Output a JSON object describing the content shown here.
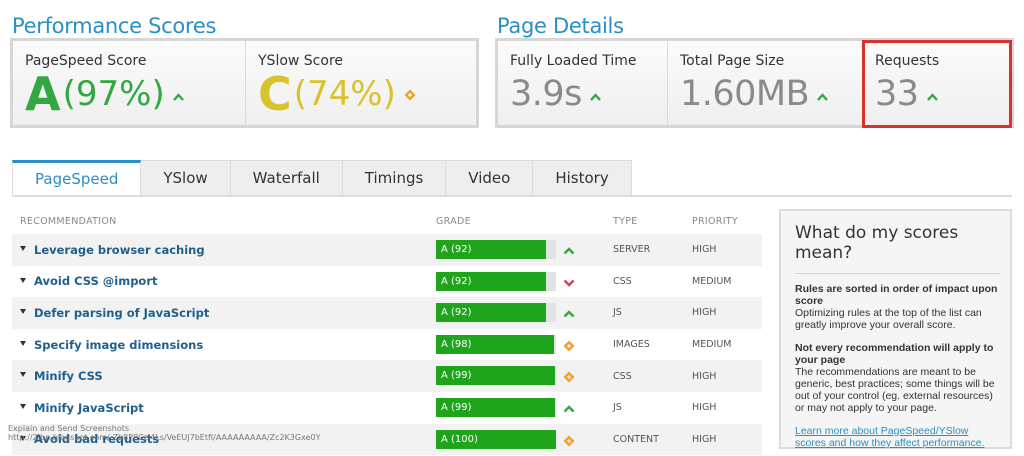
{
  "performance": {
    "title": "Performance Scores",
    "pagespeed": {
      "label": "PageSpeed Score",
      "grade": "A",
      "pct": "(97%)",
      "color": "#33a742"
    },
    "yslow": {
      "label": "YSlow Score",
      "grade": "C",
      "pct": "(74%)",
      "color": "#d9c22e"
    }
  },
  "page_details": {
    "title": "Page Details",
    "fully_loaded": {
      "label": "Fully Loaded Time",
      "value": "3.9s"
    },
    "page_size": {
      "label": "Total Page Size",
      "value": "1.60MB"
    },
    "requests": {
      "label": "Requests",
      "value": "33"
    }
  },
  "tabs": [
    "PageSpeed",
    "YSlow",
    "Waterfall",
    "Timings",
    "Video",
    "History"
  ],
  "table": {
    "headers": {
      "recommendation": "RECOMMENDATION",
      "grade": "GRADE",
      "type": "TYPE",
      "priority": "PRIORITY"
    },
    "rows": [
      {
        "name": "Leverage browser caching",
        "grade": "A (92)",
        "score": 92,
        "trend": "up-icon",
        "type": "SERVER",
        "priority": "HIGH"
      },
      {
        "name": "Avoid CSS @import",
        "grade": "A (92)",
        "score": 92,
        "trend": "down-icon",
        "type": "CSS",
        "priority": "MEDIUM"
      },
      {
        "name": "Defer parsing of JavaScript",
        "grade": "A (92)",
        "score": 92,
        "trend": "up-icon",
        "type": "JS",
        "priority": "HIGH"
      },
      {
        "name": "Specify image dimensions",
        "grade": "A (98)",
        "score": 98,
        "trend": "diamond-icon",
        "type": "IMAGES",
        "priority": "MEDIUM"
      },
      {
        "name": "Minify CSS",
        "grade": "A (99)",
        "score": 99,
        "trend": "diamond-icon",
        "type": "CSS",
        "priority": "HIGH"
      },
      {
        "name": "Minify JavaScript",
        "grade": "A (99)",
        "score": 99,
        "trend": "up-icon",
        "type": "JS",
        "priority": "HIGH"
      },
      {
        "name": "Avoid bad requests",
        "grade": "A (100)",
        "score": 100,
        "trend": "diamond-icon",
        "type": "CONTENT",
        "priority": "HIGH"
      }
    ]
  },
  "explain": {
    "title": "What do my scores mean?",
    "h1": "Rules are sorted in order of impact upon score",
    "p1": "Optimizing rules at the top of the list can greatly improve your overall score.",
    "h2": "Not every recommendation will apply to your page",
    "p2": "The recommendations are meant to be generic, best practices; some things will be out of your control (eg. external resources) or may not apply to your page.",
    "link": "Learn more about PageSpeed/YSlow scores and how they affect performance."
  },
  "watermark": {
    "line1": "Explain and Send Screenshots",
    "line2": "http://2.bp.blogspot.com/-Zb8P8Czl4Ls/VeEUJ7bEtfI/AAAAAAAAA/Zc2K3Gxe0Y"
  },
  "colors": {
    "accent": "#2a8fc7",
    "green": "#1ea51b",
    "up": "#33a742",
    "down": "#d94050",
    "diamond": "#f0a030",
    "highlight": "#d9312b"
  }
}
